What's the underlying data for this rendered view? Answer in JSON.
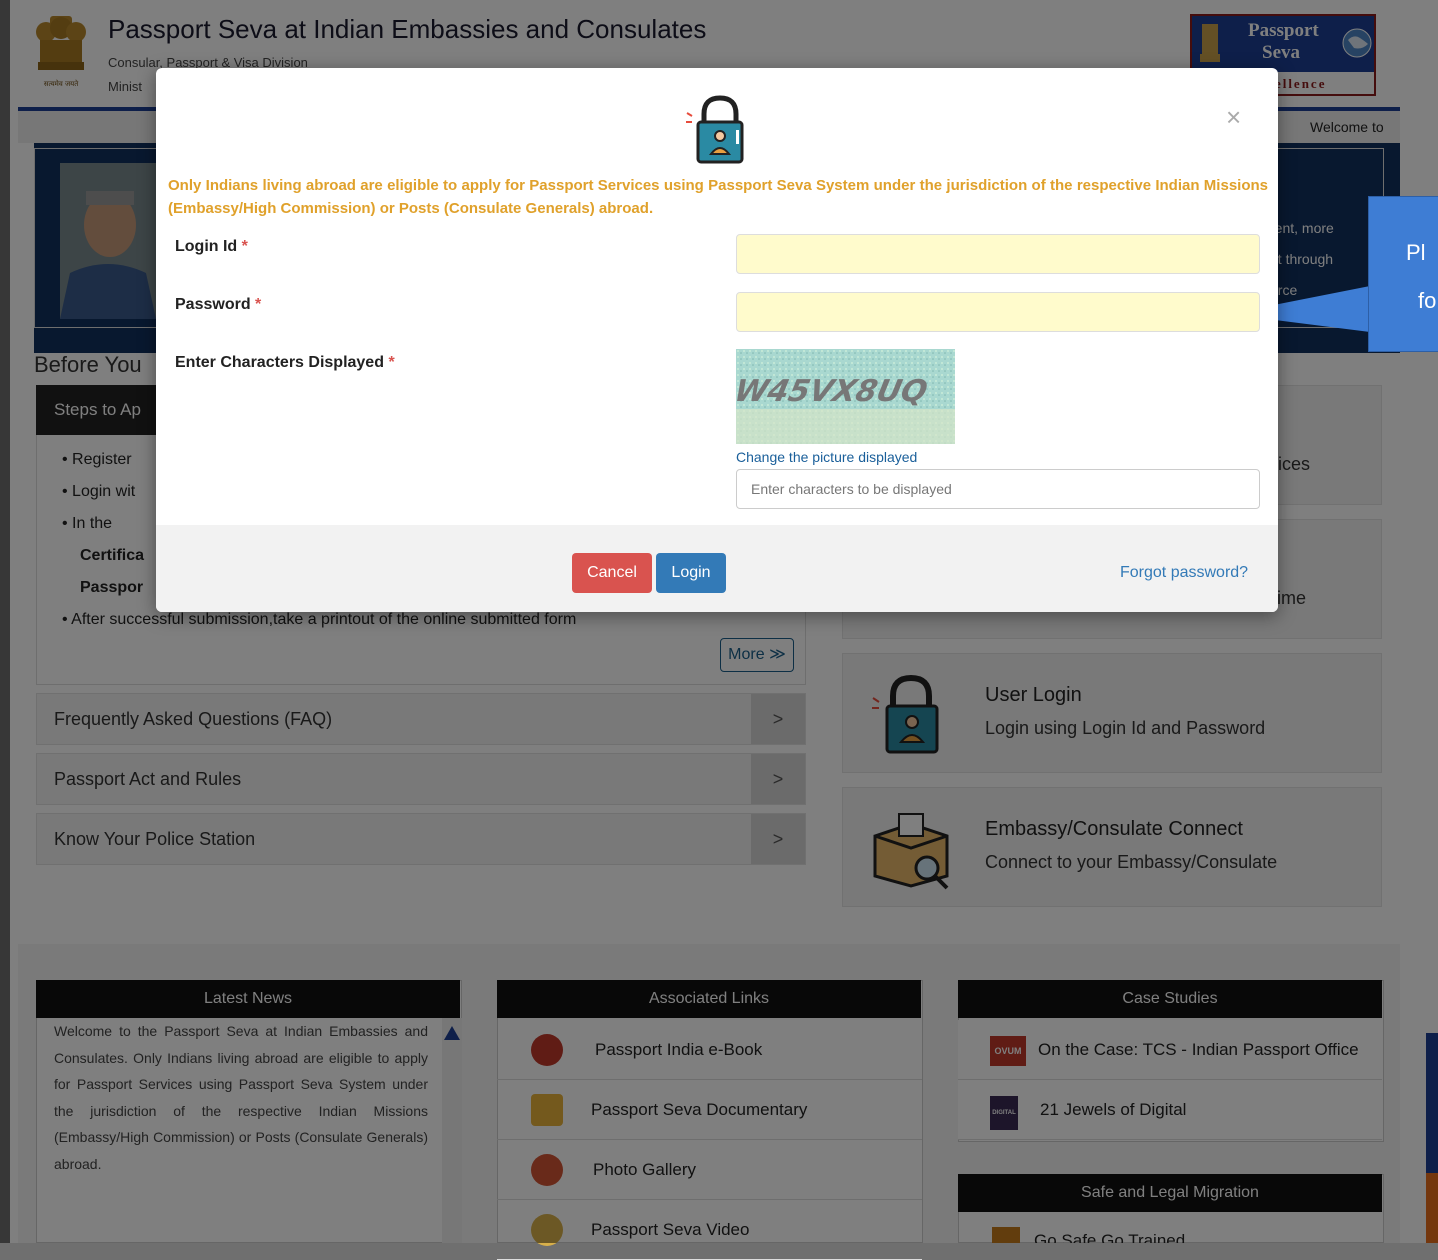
{
  "header": {
    "title": "Passport Seva at Indian Embassies and Consulates",
    "subtitle1": "Consular, Passport & Visa Division",
    "subtitle2": "Minist",
    "brand": {
      "line1": "Passport",
      "line2": "Seva",
      "line3": "Excellence"
    },
    "emblem_motto": "सत्यमेव जयते"
  },
  "navbar": {
    "welcome_ticker": "Welcome to"
  },
  "banner": {
    "text_lines": [
      "rent, more",
      "nt through",
      "orce"
    ]
  },
  "callout": {
    "line1": "Pl",
    "line2": "fo"
  },
  "before_heading": "Before You",
  "steps": {
    "tab": "Steps to Ap",
    "lines": [
      "• Register",
      "• Login wit",
      "• In the",
      "Certifica",
      "Passpor",
      "• After successful submission,take a printout of the online submitted form"
    ],
    "more": "More ≫"
  },
  "accordions": [
    {
      "label": "Frequently Asked Questions (FAQ)",
      "chevron": ">"
    },
    {
      "label": "Passport Act and Rules",
      "chevron": ">"
    },
    {
      "label": "Know Your Police Station",
      "chevron": ">"
    }
  ],
  "cards": [
    {
      "title": "",
      "desc": "rvices"
    },
    {
      "title": "",
      "desc": "l time"
    },
    {
      "title": "User Login",
      "desc": "Login using Login Id and Password",
      "icon": "lock-icon"
    },
    {
      "title": "Embassy/Consulate Connect",
      "desc": "Connect to your Embassy/Consulate",
      "icon": "package-search-icon"
    }
  ],
  "latest_news": {
    "heading": "Latest News",
    "text": "Welcome to the Passport Seva at Indian Embassies and Consulates. Only Indians living abroad are eligible to apply for Passport Services using Passport Seva System under the jurisdiction of the respective Indian Missions (Embassy/High Commission) or Posts (Consulate Generals) abroad."
  },
  "associated_links": {
    "heading": "Associated Links",
    "items": [
      {
        "label": "Passport India e-Book",
        "icon": "ebook-icon"
      },
      {
        "label": "Passport Seva Documentary",
        "icon": "video-camera-icon"
      },
      {
        "label": "Photo Gallery",
        "icon": "photo-icon"
      },
      {
        "label": "Passport Seva Video",
        "icon": "video-icon"
      }
    ]
  },
  "case_studies": {
    "heading": "Case Studies",
    "items": [
      {
        "label": "On the Case: TCS - Indian Passport Office",
        "badge": "OVUM"
      },
      {
        "label": "21 Jewels of Digital",
        "badge": "DIGITAL"
      }
    ]
  },
  "safe_migration": {
    "heading": "Safe and Legal Migration",
    "item": "Go Safe Go Trained"
  },
  "modal": {
    "notice": "Only Indians living abroad are eligible to apply for Passport Services using Passport Seva System under the jurisdiction of the respective Indian Missions (Embassy/High Commission) or Posts (Consulate Generals) abroad.",
    "login_id_label": "Login Id",
    "password_label": "Password",
    "captcha_label": "Enter Characters Displayed",
    "required_mark": "*",
    "captcha_text": "W45VX8UQ",
    "change_picture": "Change the picture displayed",
    "captcha_placeholder": "Enter characters to be displayed",
    "cancel": "Cancel",
    "login": "Login",
    "forgot": "Forgot password?",
    "close": "×"
  },
  "colors": {
    "notice": "#e0a12b",
    "primary": "#337ab7",
    "danger": "#d9534f",
    "navy": "#1c3f94"
  }
}
